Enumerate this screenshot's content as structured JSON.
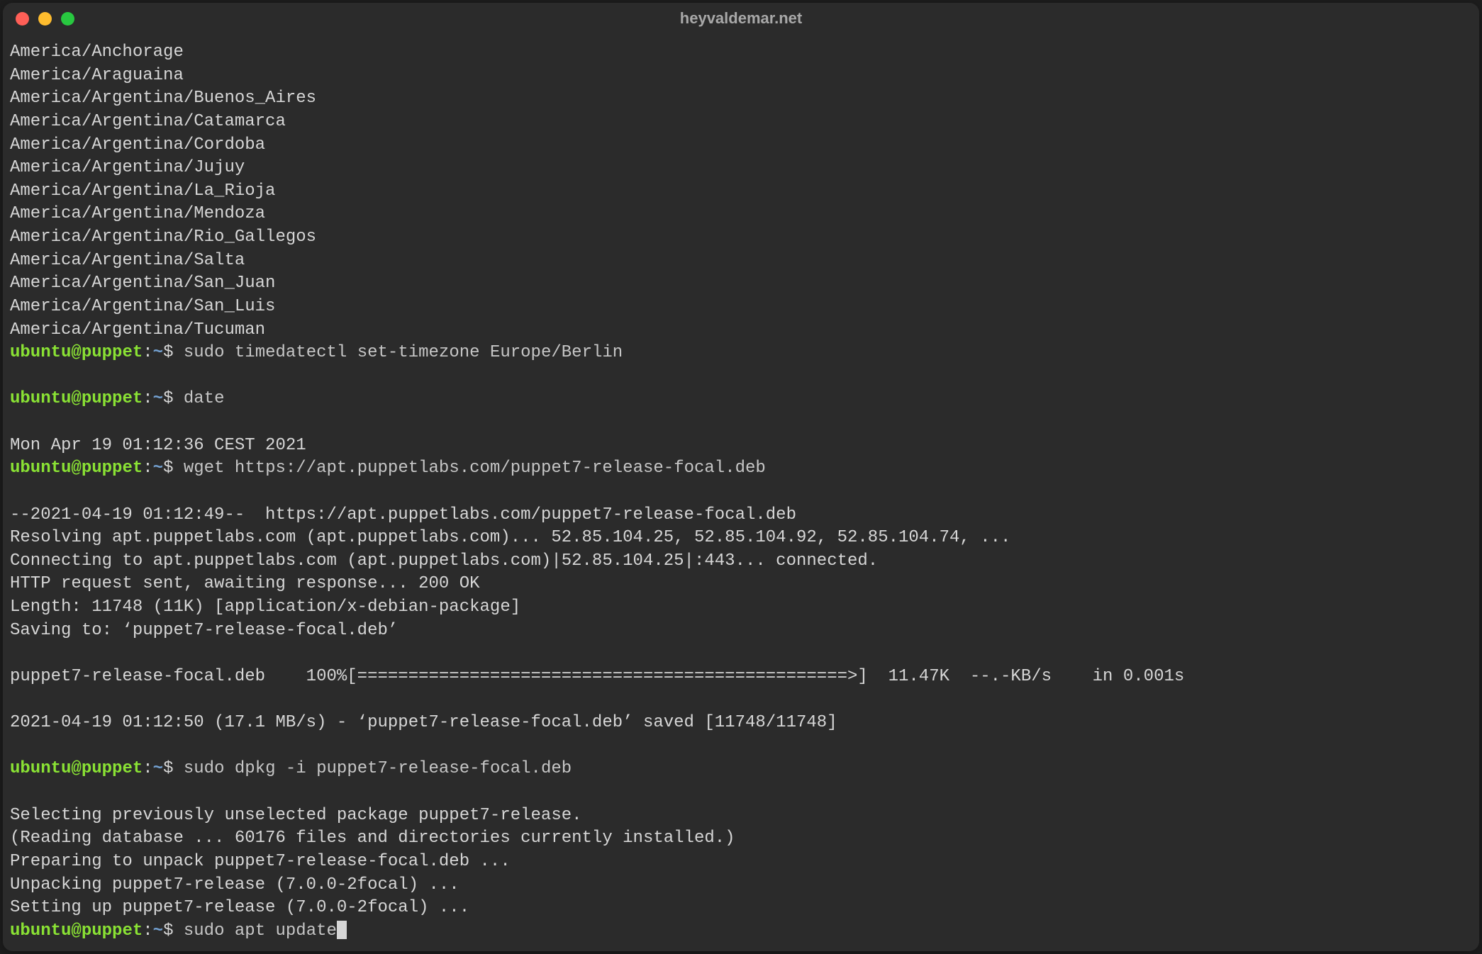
{
  "window": {
    "title": "heyvaldemar.net"
  },
  "prompt": {
    "user": "ubuntu",
    "at": "@",
    "host": "puppet",
    "colon": ":",
    "path": "~",
    "dollar": "$ "
  },
  "output": {
    "tz_list": "America/Anchorage\nAmerica/Araguaina\nAmerica/Argentina/Buenos_Aires\nAmerica/Argentina/Catamarca\nAmerica/Argentina/Cordoba\nAmerica/Argentina/Jujuy\nAmerica/Argentina/La_Rioja\nAmerica/Argentina/Mendoza\nAmerica/Argentina/Rio_Gallegos\nAmerica/Argentina/Salta\nAmerica/Argentina/San_Juan\nAmerica/Argentina/San_Luis\nAmerica/Argentina/Tucuman",
    "cmd1": "sudo timedatectl set-timezone Europe/Berlin",
    "cmd2": "date",
    "date_out": "Mon Apr 19 01:12:36 CEST 2021",
    "cmd3": "wget https://apt.puppetlabs.com/puppet7-release-focal.deb",
    "wget_out": "--2021-04-19 01:12:49--  https://apt.puppetlabs.com/puppet7-release-focal.deb\nResolving apt.puppetlabs.com (apt.puppetlabs.com)... 52.85.104.25, 52.85.104.92, 52.85.104.74, ...\nConnecting to apt.puppetlabs.com (apt.puppetlabs.com)|52.85.104.25|:443... connected.\nHTTP request sent, awaiting response... 200 OK\nLength: 11748 (11K) [application/x-debian-package]\nSaving to: ‘puppet7-release-focal.deb’\n\npuppet7-release-focal.deb    100%[================================================>]  11.47K  --.-KB/s    in 0.001s\n\n2021-04-19 01:12:50 (17.1 MB/s) - ‘puppet7-release-focal.deb’ saved [11748/11748]\n",
    "cmd4": "sudo dpkg -i puppet7-release-focal.deb",
    "dpkg_out": "Selecting previously unselected package puppet7-release.\n(Reading database ... 60176 files and directories currently installed.)\nPreparing to unpack puppet7-release-focal.deb ...\nUnpacking puppet7-release (7.0.0-2focal) ...\nSetting up puppet7-release (7.0.0-2focal) ...",
    "cmd5": "sudo apt update"
  }
}
